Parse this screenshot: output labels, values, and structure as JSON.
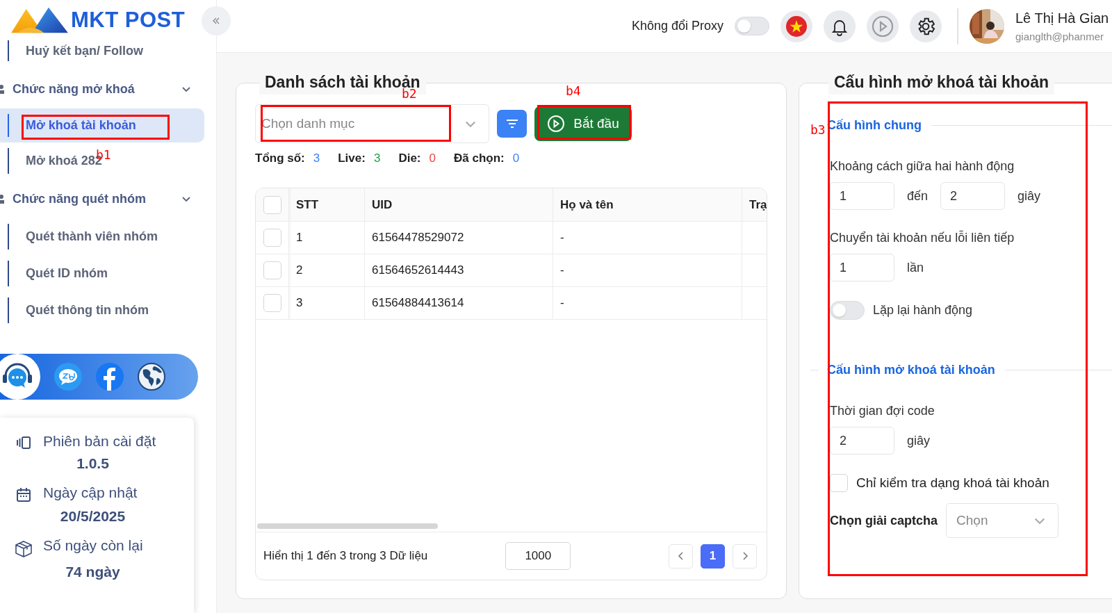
{
  "logo": {
    "text": "MKT POST"
  },
  "header": {
    "proxy_toggle": {
      "label": "Không đổi Proxy",
      "on": false
    },
    "user": {
      "name": "Lê Thị Hà Gian",
      "email": "gianglth@phanmer"
    }
  },
  "sidebar": {
    "menu": [
      {
        "kind": "item",
        "label": "Huỷ kết bạn/ Follow",
        "selected": false
      },
      {
        "kind": "group",
        "label": "Chức năng mở khoá",
        "expanded": true,
        "children": [
          {
            "label": "Mở khoá tài khoản",
            "selected": true
          },
          {
            "label": "Mở khoá 282",
            "selected": false
          }
        ]
      },
      {
        "kind": "group",
        "label": "Chức năng quét nhóm",
        "expanded": true,
        "children": [
          {
            "label": "Quét thành viên nhóm",
            "selected": false
          },
          {
            "label": "Quét ID nhóm",
            "selected": false
          },
          {
            "label": "Quét thông tin nhóm",
            "selected": false
          }
        ]
      }
    ],
    "info": [
      {
        "kind": "version",
        "label": "Phiên bản cài đặt",
        "value": "1.0.5"
      },
      {
        "kind": "date",
        "label": "Ngày cập nhật",
        "value": "20/5/2025"
      },
      {
        "kind": "days",
        "label": "Số ngày còn lại",
        "value": "74 ngày"
      }
    ]
  },
  "accounts": {
    "title": "Danh sách tài khoản",
    "category_placeholder": "Chọn danh mục",
    "start_button": "Bắt đầu",
    "stats": [
      {
        "label": "Tổng số:",
        "value": "3",
        "color": "#3b82f6"
      },
      {
        "label": "Live:",
        "value": "3",
        "color": "#16a34a"
      },
      {
        "label": "Die:",
        "value": "0",
        "color": "#ef4444"
      },
      {
        "label": "Đã chọn:",
        "value": "0",
        "color": "#3b82f6"
      }
    ],
    "table": {
      "select_all_checked": false,
      "columns": [
        "STT",
        "UID",
        "Họ và tên",
        "Trạ"
      ],
      "rows": [
        {
          "checked": false,
          "cells": [
            "1",
            "61564478529072",
            "-"
          ]
        },
        {
          "checked": false,
          "cells": [
            "2",
            "61564652614443",
            "-"
          ]
        },
        {
          "checked": false,
          "cells": [
            "3",
            "61564884413614",
            "-"
          ]
        }
      ]
    },
    "footer": {
      "summary": "Hiển thị 1 đến 3 trong 3 Dữ liệu",
      "page_size": "1000",
      "pages": [
        {
          "label": "1",
          "selected": true
        }
      ]
    }
  },
  "config": {
    "title": "Cấu hình mở khoá tài khoản",
    "sections": [
      {
        "title": "Cấu hình chung",
        "fields": [
          {
            "kind": "range",
            "label": "Khoảng cách giữa hai hành động",
            "from": "1",
            "joiner": "đến",
            "to": "2",
            "unit": "giây"
          },
          {
            "kind": "number",
            "label": "Chuyển tài khoản nếu lỗi liên tiếp",
            "value": "1",
            "unit": "lần"
          },
          {
            "kind": "toggle",
            "label": "Lặp lại hành động",
            "on": false
          }
        ]
      },
      {
        "title": "Cấu hình mở khoá tài khoản",
        "fields": [
          {
            "kind": "number",
            "label": "Thời gian đợi code",
            "value": "2",
            "unit": "giây"
          },
          {
            "kind": "checkbox",
            "label": "Chỉ kiểm tra dạng khoá tài khoản",
            "checked": false
          },
          {
            "kind": "select",
            "label": "Chọn giải captcha",
            "placeholder": "Chọn"
          }
        ]
      }
    ]
  },
  "annotations": [
    {
      "label": "b1"
    },
    {
      "label": "b2"
    },
    {
      "label": "b3"
    },
    {
      "label": "b4"
    }
  ]
}
